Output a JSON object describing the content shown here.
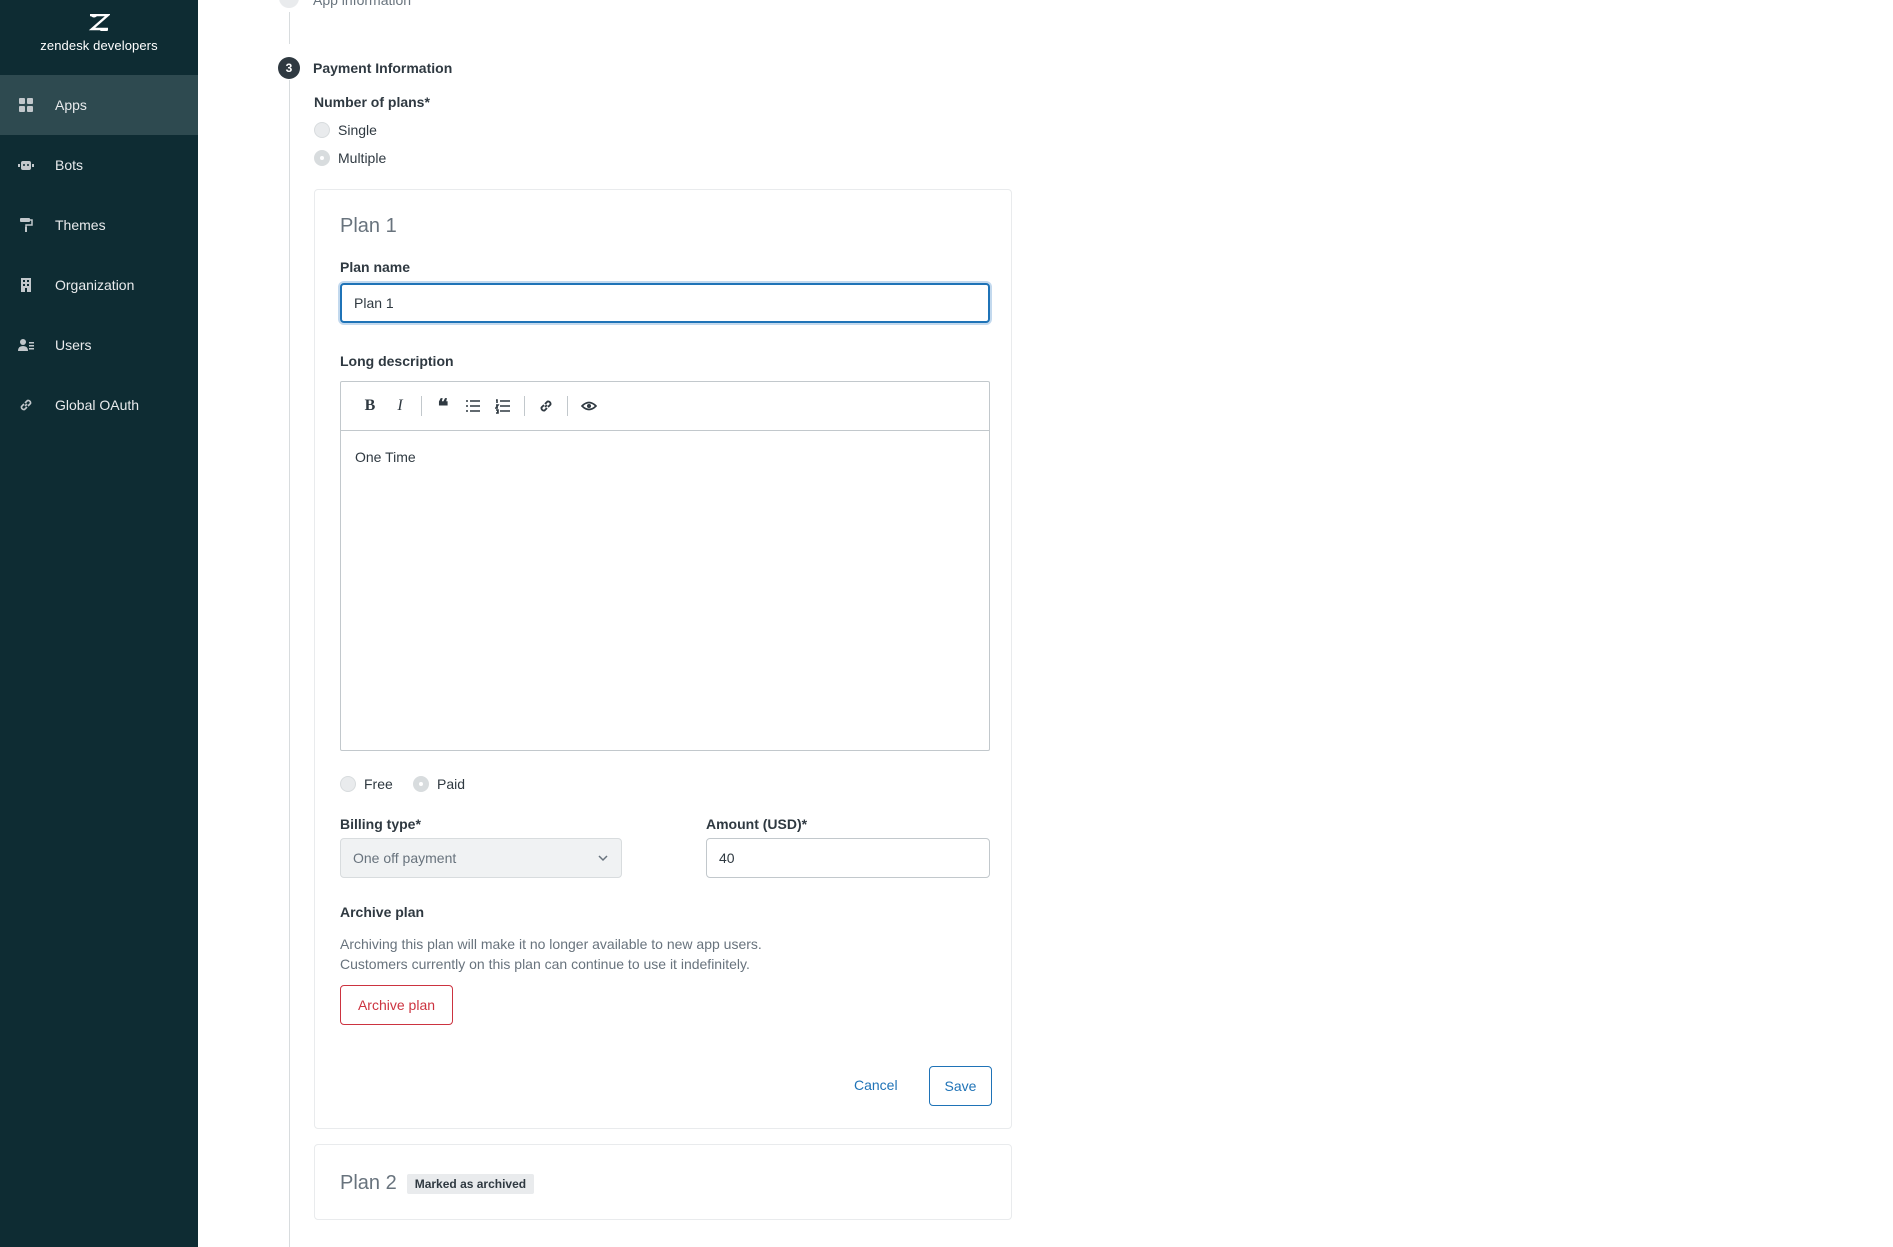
{
  "sidebar": {
    "brand": "zendesk developers",
    "items": [
      {
        "label": "Apps",
        "icon": "grid-icon"
      },
      {
        "label": "Bots",
        "icon": "bot-icon"
      },
      {
        "label": "Themes",
        "icon": "paint-roller-icon"
      },
      {
        "label": "Organization",
        "icon": "building-icon"
      },
      {
        "label": "Users",
        "icon": "users-icon"
      },
      {
        "label": "Global OAuth",
        "icon": "link-icon"
      }
    ]
  },
  "stepper": {
    "prev_title": "App information",
    "step_number": "3",
    "step_title": "Payment Information"
  },
  "plans": {
    "label": "Number of plans*",
    "options": [
      "Single",
      "Multiple"
    ],
    "selected": "Multiple"
  },
  "plan1": {
    "title": "Plan 1",
    "name_label": "Plan name",
    "name_value": "Plan 1",
    "description_label": "Long description",
    "description_value": "One Time",
    "pricing_options": [
      "Free",
      "Paid"
    ],
    "pricing_selected": "Paid",
    "billing_label": "Billing type*",
    "billing_value": "One off payment",
    "amount_label": "Amount (USD)*",
    "amount_value": "40",
    "archive_label": "Archive plan",
    "archive_help_1": "Archiving this plan will make it no longer available to new app users.",
    "archive_help_2": "Customers currently on this plan can continue to use it indefinitely.",
    "archive_button": "Archive plan",
    "cancel_button": "Cancel",
    "save_button": "Save"
  },
  "plan2": {
    "title": "Plan 2",
    "badge": "Marked as archived"
  },
  "colors": {
    "sidebar_bg": "#0e2c33",
    "sidebar_active": "#2e4a50",
    "accent": "#1f73b7",
    "danger": "#cc3340"
  }
}
